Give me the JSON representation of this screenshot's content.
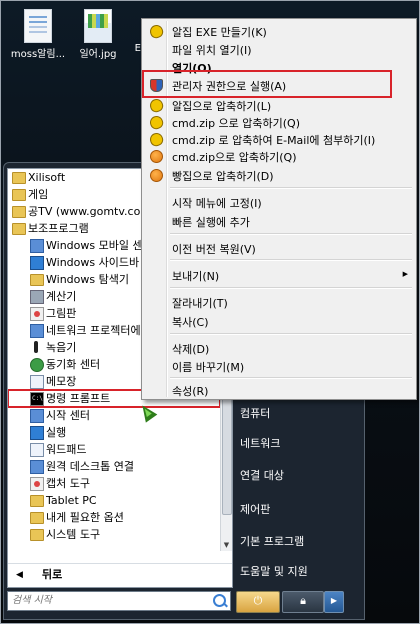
{
  "desktop": {
    "icons": [
      {
        "label": "moss알림..."
      },
      {
        "label": "일어.jpg"
      },
      {
        "label": "E"
      }
    ]
  },
  "start_menu": {
    "programs": [
      {
        "label": "Xilisoft",
        "icon": "folder-icon"
      },
      {
        "label": "게임",
        "icon": "folder-icon"
      },
      {
        "label": "공TV (www.gomtv.com)",
        "icon": "folder-icon"
      },
      {
        "label": "보조프로그램",
        "icon": "folder-icon"
      },
      {
        "label": "Windows 모바일 센터",
        "icon": "mobility-center-icon"
      },
      {
        "label": "Windows 사이드바",
        "icon": "sidebar-icon"
      },
      {
        "label": "Windows 탐색기",
        "icon": "explorer-icon"
      },
      {
        "label": "계산기",
        "icon": "calculator-icon"
      },
      {
        "label": "그림판",
        "icon": "paint-icon"
      },
      {
        "label": "네트워크 프로젝터에",
        "icon": "network-projector-icon"
      },
      {
        "label": "녹음기",
        "icon": "sound-recorder-icon"
      },
      {
        "label": "동기화 센터",
        "icon": "sync-center-icon"
      },
      {
        "label": "메모장",
        "icon": "notepad-icon"
      },
      {
        "label": "명령 프롬프트",
        "icon": "command-prompt-icon",
        "highlighted": true
      },
      {
        "label": "시작 센터",
        "icon": "welcome-center-icon"
      },
      {
        "label": "실행",
        "icon": "run-icon"
      },
      {
        "label": "워드패드",
        "icon": "wordpad-icon"
      },
      {
        "label": "원격 데스크톱 연결",
        "icon": "remote-desktop-icon"
      },
      {
        "label": "캡처 도구",
        "icon": "snipping-tool-icon"
      },
      {
        "label": "Tablet PC",
        "icon": "folder-icon"
      },
      {
        "label": "내게 필요한 옵션",
        "icon": "folder-icon"
      },
      {
        "label": "시스템 도구",
        "icon": "folder-icon"
      }
    ],
    "back_label": "뒤로",
    "search_placeholder": "검색 시작",
    "right_pane": [
      "컴퓨터",
      "네트워크",
      "연결 대상",
      "제어판",
      "기본 프로그램",
      "도움말 및 지원"
    ]
  },
  "context_menu": {
    "items": [
      {
        "label": "알집 EXE 만들기(K)",
        "icon": "alzip-icon"
      },
      {
        "label": "파일 위치 열기(I)",
        "icon": ""
      },
      {
        "label": "열기(O)",
        "icon": "",
        "bold": true
      },
      {
        "label": "관리자 권한으로 실행(A)",
        "icon": "uac-shield-icon",
        "highlighted": true
      },
      {
        "label": "알집으로 압축하기(L)",
        "icon": "alzip-icon"
      },
      {
        "label": "cmd.zip 으로 압축하기(Q)",
        "icon": "alzip-icon"
      },
      {
        "label": "cmd.zip 로 압축하여 E-Mail에 첨부하기(I)",
        "icon": "alzip-icon"
      },
      {
        "label": "cmd.zip으로 압축하기(Q)",
        "icon": "bandizip-icon"
      },
      {
        "label": "빵집으로 압축하기(D)",
        "icon": "bandizip-icon"
      },
      {
        "label": "시작 메뉴에 고정(I)",
        "icon": ""
      },
      {
        "label": "빠른 실행에 추가",
        "icon": ""
      },
      {
        "label": "이전 버전 복원(V)",
        "icon": ""
      },
      {
        "label": "보내기(N)",
        "icon": "",
        "submenu": true
      },
      {
        "label": "잘라내기(T)",
        "icon": ""
      },
      {
        "label": "복사(C)",
        "icon": ""
      },
      {
        "label": "삭제(D)",
        "icon": ""
      },
      {
        "label": "이름 바꾸기(M)",
        "icon": ""
      },
      {
        "label": "속성(R)",
        "icon": ""
      }
    ]
  }
}
